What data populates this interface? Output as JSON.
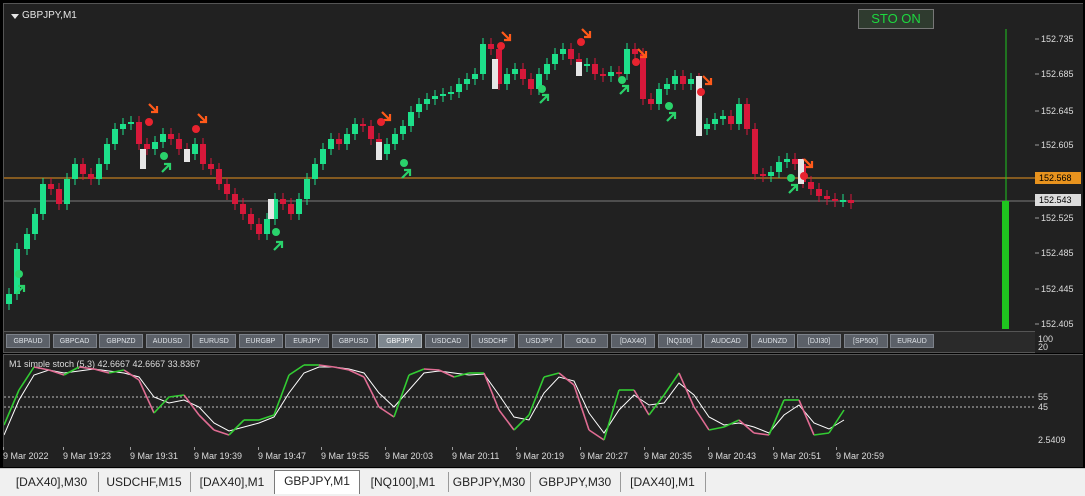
{
  "chart": {
    "symbol_title": "GBPJPY,M1",
    "sto_button": "STO ON",
    "price_labels": [
      "152.735",
      "152.685",
      "152.645",
      "152.605",
      "152.525",
      "152.485",
      "152.445",
      "152.405"
    ],
    "bid_label": "152.568",
    "last_label": "152.543",
    "colors": {
      "bull": "#1de08a",
      "bear": "#d7183a",
      "neutral": "#e6e6e6",
      "bid_line": "#e8931e",
      "signal_up": "#2ad26b",
      "signal_down": "#ff5a1a",
      "signal_dot_down": "#e8232f",
      "stoch_main": "#33cc33",
      "stoch_main_down": "#e06c93",
      "stoch_signal": "#ffffff",
      "volume_bar": "#1fc51f"
    }
  },
  "symbol_buttons": [
    "GBPAUD",
    "GBPCAD",
    "GBPNZD",
    "AUDUSD",
    "EURUSD",
    "EURGBP",
    "EURJPY",
    "GBPUSD",
    "GBPJPY",
    "USDCAD",
    "USDCHF",
    "USDJPY",
    "GOLD",
    "[DAX40]",
    "[NQ100]",
    "AUDCAD",
    "AUDNZD",
    "[DJI30]",
    "[SP500]",
    "EURAUD"
  ],
  "active_symbol": "GBPJPY",
  "stoch": {
    "title": "M1  simple stoch (5,3) 42.6667 42.6667 33.8367",
    "axis_labels": {
      "top": "100",
      "upper2": "20",
      "l55": "55",
      "l45": "45",
      "bottom": "2.5409"
    }
  },
  "time_labels": [
    "9 Mar 2022",
    "9 Mar 19:23",
    "9 Mar 19:31",
    "9 Mar 19:39",
    "9 Mar 19:47",
    "9 Mar 19:55",
    "9 Mar 20:03",
    "9 Mar 20:11",
    "9 Mar 20:19",
    "9 Mar 20:27",
    "9 Mar 20:35",
    "9 Mar 20:43",
    "9 Mar 20:51",
    "9 Mar 20:59"
  ],
  "tabs": [
    "[DAX40],M30",
    "USDCHF,M15",
    "[DAX40],M1",
    "GBPJPY,M1",
    "[NQ100],M1",
    "GBPJPY,M30",
    "GBPJPY,M30",
    "[DAX40],M1"
  ],
  "active_tab": "GBPJPY,M1"
}
